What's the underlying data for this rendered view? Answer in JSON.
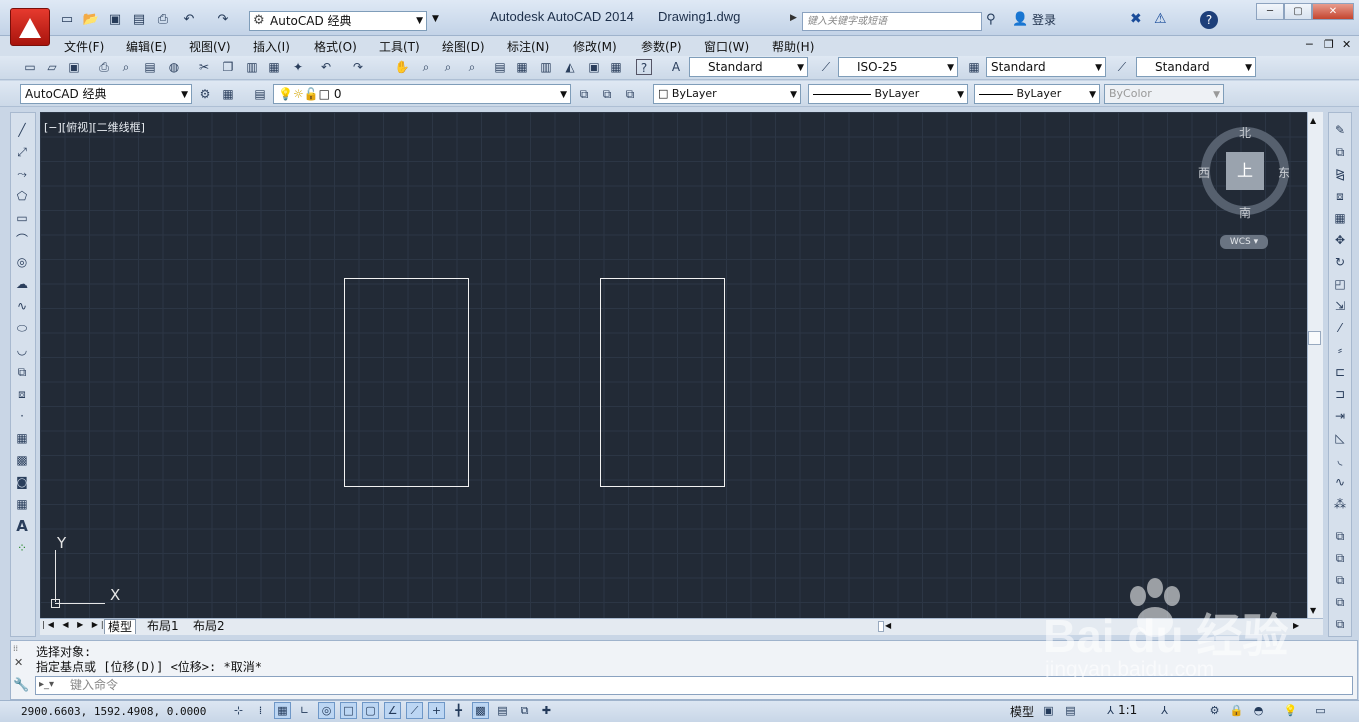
{
  "title_bar": {
    "app_letter": "A",
    "workspace": "AutoCAD 经典",
    "app_title": "Autodesk AutoCAD 2014",
    "file_name": "Drawing1.dwg",
    "search_placeholder": "键入关键字或短语",
    "login_label": "登录"
  },
  "menu": [
    "文件(F)",
    "编辑(E)",
    "视图(V)",
    "插入(I)",
    "格式(O)",
    "工具(T)",
    "绘图(D)",
    "标注(N)",
    "修改(M)",
    "参数(P)",
    "窗口(W)",
    "帮助(H)"
  ],
  "toolbar1": {
    "text_style": "Standard",
    "dim_style": "ISO-25",
    "table_style": "Standard",
    "multileader_style": "Standard"
  },
  "toolbar2": {
    "workspace": "AutoCAD 经典",
    "layer": "0",
    "color": "ByLayer",
    "linetype": "ByLayer",
    "lineweight": "ByLayer",
    "plot_style": "ByColor"
  },
  "viewport": {
    "label": "[−][俯视][二维线框]",
    "compass": {
      "north": "北",
      "south": "南",
      "east": "东",
      "west": "西",
      "top": "上"
    },
    "ucs_label": "WCS",
    "axis_y": "Y",
    "axis_x": "X"
  },
  "tabs": [
    "模型",
    "布局1",
    "布局2"
  ],
  "command": {
    "line1": "选择对象:",
    "line2": "指定基点或 [位移(D)] <位移>: *取消*",
    "input_placeholder": "键入命令"
  },
  "status": {
    "coords": "2900.6603, 1592.4908, 0.0000",
    "model_label": "模型",
    "scale": "1:1"
  },
  "watermark": {
    "text": "Bai du 经验",
    "url": "jingyan.baidu.com"
  },
  "colors": {
    "canvas_bg": "#222a36",
    "app_red": "#c8231a",
    "chrome_blue": "#d4dfec"
  }
}
